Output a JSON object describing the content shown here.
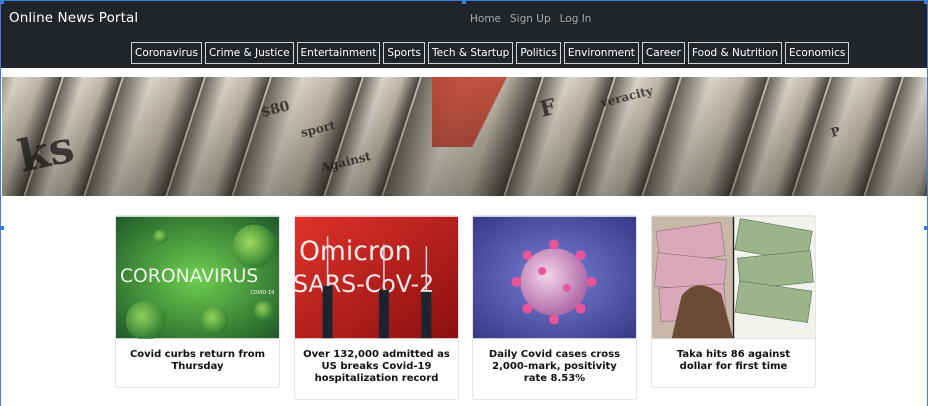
{
  "header": {
    "brand": "Online News Portal",
    "links": [
      "Home",
      "Sign Up",
      "Log In"
    ]
  },
  "categories": [
    "Coronavirus",
    "Crime & Justice",
    "Entertainment",
    "Sports",
    "Tech & Startup",
    "Politics",
    "Environment",
    "Career",
    "Food & Nutrition",
    "Economics"
  ],
  "hero": {
    "description_icon": "newspaper-stack-banner"
  },
  "articles": [
    {
      "title": "Covid curbs return from Thursday",
      "image_text": "CORONAVIRUS",
      "image_subtext": "COVID-19"
    },
    {
      "title": "Over 132,000 admitted as US breaks Covid-19 hospitalization record",
      "image_text": "Omicron",
      "image_subtext": "SARS-CoV-2"
    },
    {
      "title": "Daily Covid cases cross 2,000-mark, positivity rate 8.53%",
      "image_text": "",
      "image_subtext": ""
    },
    {
      "title": "Taka hits 86 against dollar for first time",
      "image_text": "",
      "image_subtext": ""
    }
  ],
  "colors": {
    "navbar": "#212529",
    "link_muted": "#a5aab0",
    "selection": "#3b7ddd"
  }
}
